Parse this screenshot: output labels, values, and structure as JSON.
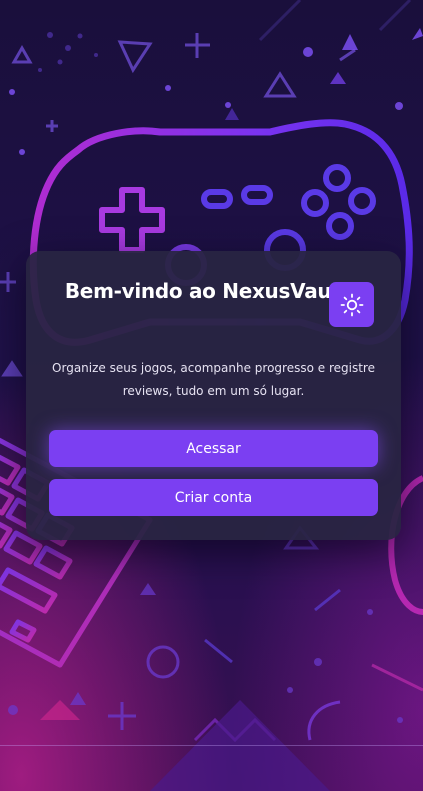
{
  "welcome": {
    "title": "Bem-vindo ao NexusVault",
    "description": "Organize seus jogos, acompanhe progresso e registre reviews, tudo em um só lugar.",
    "theme_toggle_icon": "sun-icon",
    "login_label": "Acessar",
    "signup_label": "Criar conta"
  },
  "colors": {
    "accent": "#7b3ff2",
    "card_background": "#28243f",
    "background_dark": "#1a0f3c",
    "background_magenta": "#c41aa0"
  }
}
